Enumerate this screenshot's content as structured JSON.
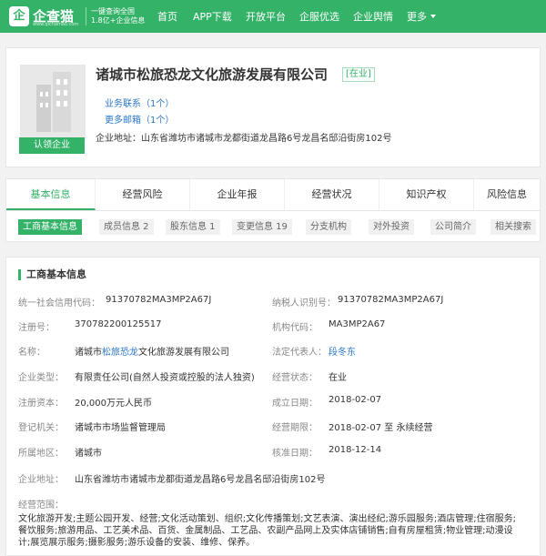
{
  "topbar": {
    "logo_badge": "企",
    "logo_text": "企查猫",
    "logo_url": "www.qichamao.com",
    "slogan_line1": "一键查询全国",
    "slogan_line2": "1.8亿+企业信息",
    "nav": [
      "首页",
      "APP下载",
      "开放平台",
      "企服优选",
      "企业舆情",
      "更多"
    ],
    "accent_color": "#34b268"
  },
  "company": {
    "name": "诸城市松旅恐龙文化旅游发展有限公司",
    "status_tag": "[在业]",
    "business_contact": "业务联系（1个）",
    "more_emails": "更多邮箱（1个）",
    "address_label": "企业地址：",
    "address": "山东省潍坊市诸城市龙都街道龙昌路6号龙昌名邸沿街房102号",
    "claim_button": "认领企业"
  },
  "tabs": [
    "基本信息",
    "经营风险",
    "企业年报",
    "经营状况",
    "知识产权",
    "风险信息"
  ],
  "subtabs": [
    "工商基本信息",
    "成员信息 2",
    "股东信息 1",
    "变更信息 19",
    "分支机构",
    "对外投资",
    "公司简介",
    "相关搜索"
  ],
  "info": {
    "section_title": "工商基本信息",
    "credit_code_label": "统一社会信用代码：",
    "credit_code": "91370782MA3MP2A67J",
    "taxpayer_label": "纳税人识别号：",
    "taxpayer_id": "91370782MA3MP2A67J",
    "reg_no_label": "注册号：",
    "reg_no": "370782200125517",
    "org_code_label": "机构代码：",
    "org_code": "MA3MP2A67",
    "name_label": "名称：",
    "name_pre": "诸城市",
    "name_hl": "松旅恐龙",
    "name_post": "文化旅游发展有限公司",
    "legal_rep_label": "法定代表人：",
    "legal_rep": "段冬东",
    "type_label": "企业类型：",
    "type": "有限责任公司(自然人投资或控股的法人独资)",
    "op_status_label": "经营状态：",
    "op_status": "在业",
    "capital_label": "注册资本：",
    "capital": "20,000万元人民币",
    "founded_label": "成立日期：",
    "founded": "2018-02-07",
    "authority_label": "登记机关：",
    "authority": "诸城市市场监督管理局",
    "term_label": "经营期限：",
    "term": "2018-02-07 至 永续经营",
    "region_label": "所属地区：",
    "region": "诸城市",
    "approved_label": "核准日期：",
    "approved": "2018-12-14",
    "address_label": "企业地址：",
    "address": "山东省潍坊市诸城市龙都街道龙昌路6号龙昌名邸沿街房102号",
    "scope_label": "经营范围：",
    "scope_line1": "文化旅游开发;主题公园开发、经营;文化活动策划、组织;文化传播策划;文艺表演、演出经纪;游乐园服务;酒店管理;住宿服务;",
    "scope_line2": "餐饮服务;旅游用品、工艺美术品、百货、金属制品、工艺品、农副产品网上及实体店铺销售;自有房屋租赁;物业管理;动漫设",
    "scope_line3": "计;展览展示服务;摄影服务;游乐设备的安装、维修、保养。"
  }
}
